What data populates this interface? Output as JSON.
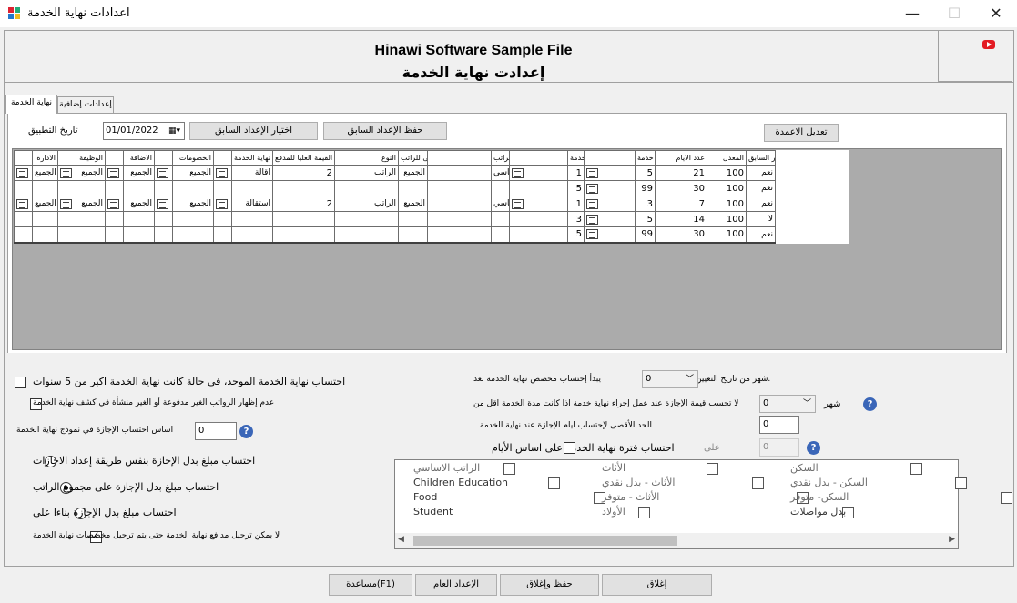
{
  "window": {
    "title": "اعدادات نهاية الخدمة",
    "minimize": "—",
    "maximize": "☐",
    "close": "✕"
  },
  "header": {
    "title_en": "Hinawi Software Sample File",
    "title_ar": "إعدادت نهاية الخدمة"
  },
  "tabs": [
    {
      "label": "نهاية الخدمة",
      "active": true
    },
    {
      "label": "إعدادات إضافية",
      "active": false
    }
  ],
  "toolbar": {
    "date_label": "تاريخ التطبيق",
    "date_value": "01/01/2022",
    "choose_prev": "اختيار الإعداد السابق",
    "save_prev": "حفظ الإعداد السابق",
    "edit_columns": "تعديل الاعمدة"
  },
  "grid": {
    "headers": [
      "الادارة",
      "الوظيفة",
      "الاضافة",
      "الخصومات",
      "سبب نهاية الخدمة",
      "القيمة العليا للمدفع",
      "النوع",
      "الحد الاعلى للراتب",
      "بنود الراتب",
      "من فترة خدمة",
      "الى فترة خدمة",
      "عدد الايام",
      "المعدل",
      "إعتماد السطر السابق"
    ],
    "rows": [
      [
        "الجميع",
        "الجميع",
        "الجميع",
        "الجميع",
        "اقالة",
        "2",
        "الراتب",
        "الجميع",
        "الراتب الاساسي",
        "1",
        "5",
        "21",
        "100",
        "نعم"
      ],
      [
        "",
        "",
        "",
        "",
        "",
        "",
        "",
        "",
        "",
        "5",
        "99",
        "30",
        "100",
        "نعم"
      ],
      [
        "الجميع",
        "الجميع",
        "الجميع",
        "الجميع",
        "استقالة",
        "2",
        "الراتب",
        "الجميع",
        "الراتب الاساسي",
        "1",
        "3",
        "7",
        "100",
        "نعم"
      ],
      [
        "",
        "",
        "",
        "",
        "",
        "",
        "",
        "",
        "",
        "3",
        "5",
        "14",
        "100",
        "لا"
      ],
      [
        "",
        "",
        "",
        "",
        "",
        "",
        "",
        "",
        "",
        "5",
        "99",
        "30",
        "100",
        "نعم"
      ]
    ]
  },
  "left_options": {
    "cb1": "احتساب نهاية الخدمة الموحد، في حالة كانت  نهاية الخدمة اكبر من 5 سنوات",
    "cb2": "عدم إظهار الرواتب الغير مدفوعة أو الغير منشأة في كشف نهاية الخدمة",
    "leave_basis_label": "اساس احتساب الإجازة في نموذج نهاية الخدمة",
    "leave_basis_value": "0",
    "rb1": "احتساب مبلغ بدل الإجازة بنفس طريقة إعداد الاجازات",
    "rb2": "احتساب مبلغ بدل الإجازة على مجموع الراتب",
    "rb3": "احتساب مبلغ بدل الإجازة بناءا على",
    "cb3": "لا يمكن ترحيل مدافع نهاية الخدمة حتى يتم ترحيل مخصصات نهاية الخدمة"
  },
  "right_options": {
    "start_label": "يبدأ إحتساب مخصص نهاية الخدمة بعد",
    "start_value": "0",
    "start_suffix": "شهر من تاريخ التعيين.",
    "no_leave_label": "لا تحسب قيمة الإجازة عند عمل إجراء نهاية خدمة اذا كانت مدة الخدمة اقل من",
    "no_leave_value": "0",
    "no_leave_suffix": "شهر",
    "max_days_label": "الحد الأقصى لإحتساب ايام الإجازة عند نهاية الخدمة",
    "max_days_value": "0",
    "period_label": "احتساب فترة نهاية الخدمة على اساس الأيام",
    "on_label": "على",
    "on_value": "0"
  },
  "salary_items": [
    [
      "الراتب الاساسي",
      "الأثاث",
      "السكن"
    ],
    [
      "Children Education",
      "الأثاث - بدل نقدي",
      "السكن - بدل نقدي"
    ],
    [
      "Food",
      "الأثاث - متوفر",
      "السكن- متوفر"
    ],
    [
      "Student",
      "الأولاد",
      "بدل مواصلات"
    ]
  ],
  "footer": {
    "help": "مساعدة(F1)",
    "general": "الإعداد العام",
    "save_close": "حفظ وإغلاق",
    "close": "إغلاق"
  },
  "colors": {
    "accent_help": "#3a66b8",
    "youtube": "#e31b23",
    "grid_bg": "#ababab"
  },
  "icons": [
    "app-icon",
    "youtube-icon",
    "calendar-icon",
    "help-icon",
    "row-picker-icon"
  ]
}
